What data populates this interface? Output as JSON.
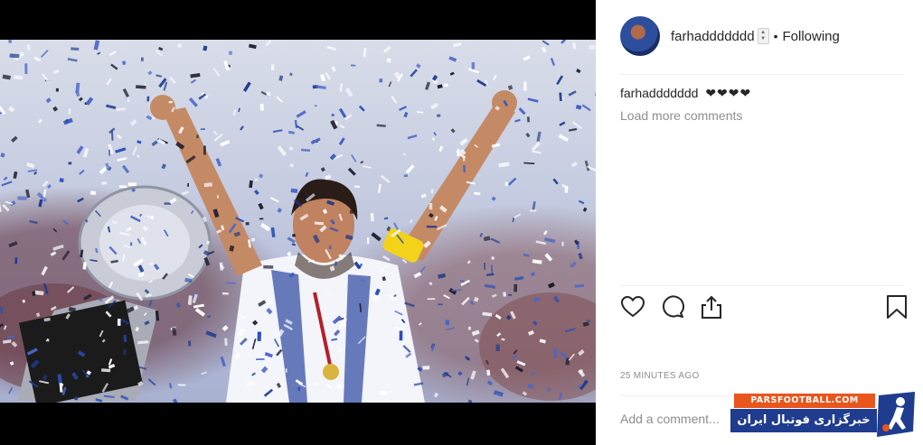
{
  "post": {
    "username": "farhaddddddd",
    "separator": "•",
    "follow_status": "Following",
    "caption_user": "farhaddddddd",
    "caption_text": "❤❤❤❤",
    "load_more": "Load more comments",
    "timestamp": "25 MINUTES AGO",
    "comment_placeholder": "Add a comment..."
  },
  "actions": {
    "icons": [
      "heart-icon",
      "comment-icon",
      "share-icon",
      "bookmark-icon"
    ]
  },
  "watermark": {
    "top_text": "PARSFOOTBALL.COM",
    "bottom_text": "خبرگزاری فوتبال ایران",
    "colors": {
      "orange": "#e8561c",
      "blue": "#1f3c8f"
    }
  },
  "colors": {
    "text": "#262626",
    "muted": "#8e8e8e",
    "divider": "#efefef",
    "confetti_blue": "#2a4fb8"
  }
}
